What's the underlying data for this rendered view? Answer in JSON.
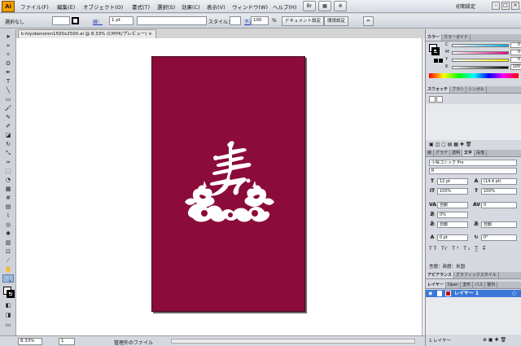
{
  "app": {
    "logo": "Ai",
    "workspace": "初期設定"
  },
  "menu": [
    "ファイル(F)",
    "編集(E)",
    "オブジェクト(O)",
    "書式(T)",
    "選択(S)",
    "効果(C)",
    "表示(V)",
    "ウィンドウ(W)",
    "ヘルプ(H)"
  ],
  "control": {
    "selection": "選択なし",
    "stroke_link": "線：",
    "stroke_width": "1 pt",
    "style_label": "スタイル：",
    "opacity_link": "不透明度：",
    "opacity_value": "100",
    "opacity_unit": "%",
    "doc_setup": "ドキュメント設定",
    "prefs": "環境設定"
  },
  "document": {
    "tab_title": "k-hiyokenoren1500x2500.ai @ 8.33% (CMYK/プレビュー)",
    "artboard_color": "#8b0b3a"
  },
  "status": {
    "zoom": "8.33%",
    "artboard_num": "1",
    "info": "管理外のファイル"
  },
  "color_panel": {
    "tabs": [
      "カラー",
      "カラーガイド"
    ],
    "channels": [
      {
        "label": "C",
        "value": "0",
        "from": "#ffffff",
        "to": "#00aeef"
      },
      {
        "label": "M",
        "value": "0",
        "from": "#ffffff",
        "to": "#ec008c"
      },
      {
        "label": "Y",
        "value": "0",
        "from": "#ffffff",
        "to": "#fff200"
      },
      {
        "label": "K",
        "value": "100",
        "from": "#ffffff",
        "to": "#000000"
      }
    ]
  },
  "swatch_panel": {
    "tabs": [
      "スウォッチ",
      "ブラシ",
      "シンボル"
    ]
  },
  "char_panel": {
    "tabs": [
      "線",
      "グラデ",
      "透明",
      "文字",
      "段落"
    ],
    "font": "小塚ゴシック Pro",
    "style": "R",
    "size": "12 pt",
    "leading": "(14.4 pt)",
    "h_scale": "100%",
    "v_scale": "100%",
    "kerning": "自動",
    "tracking": "0",
    "tsume": "0%",
    "aki_left": "自動",
    "aki_right": "自動",
    "baseline": "0 pt",
    "rotation": "0°",
    "language": "言語：英語：米国"
  },
  "appearance_panel": {
    "tabs": [
      "アピアランス",
      "グラフィックスタイル"
    ]
  },
  "layers_panel": {
    "tabs": [
      "レイヤー",
      "Open",
      "変形",
      "パス",
      "整列"
    ],
    "layer_name": "レイヤー 1",
    "count": "1 レイヤー"
  }
}
